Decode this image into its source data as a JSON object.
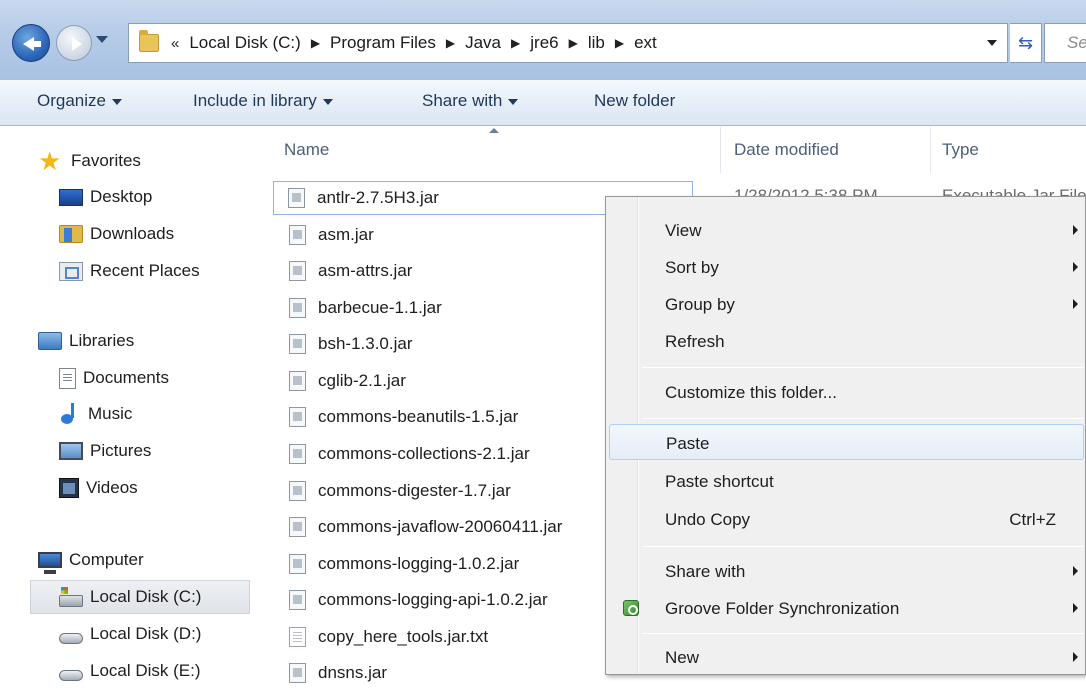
{
  "address": {
    "overflow": "«",
    "crumbs": [
      "Local Disk (C:)",
      "Program Files",
      "Java",
      "jre6",
      "lib",
      "ext"
    ],
    "search_placeholder": "Sear"
  },
  "toolbar": {
    "organize": "Organize",
    "include_in_library": "Include in library",
    "share_with": "Share with",
    "new_folder": "New folder"
  },
  "nav": {
    "favorites": "Favorites",
    "desktop": "Desktop",
    "downloads": "Downloads",
    "recent_places": "Recent Places",
    "libraries": "Libraries",
    "documents": "Documents",
    "music": "Music",
    "pictures": "Pictures",
    "videos": "Videos",
    "computer": "Computer",
    "local_disk_c": "Local Disk (C:)",
    "local_disk_d": "Local Disk (D:)",
    "local_disk_e": "Local Disk (E:)"
  },
  "columns": {
    "name": "Name",
    "date_modified": "Date modified",
    "type": "Type"
  },
  "files": [
    "antlr-2.7.5H3.jar",
    "asm.jar",
    "asm-attrs.jar",
    "barbecue-1.1.jar",
    "bsh-1.3.0.jar",
    "cglib-2.1.jar",
    "commons-beanutils-1.5.jar",
    "commons-collections-2.1.jar",
    "commons-digester-1.7.jar",
    "commons-javaflow-20060411.jar",
    "commons-logging-1.0.2.jar",
    "commons-logging-api-1.0.2.jar",
    "copy_here_tools.jar.txt",
    "dnsns.jar"
  ],
  "first_row": {
    "date": "1/28/2012 5:38 PM",
    "type": "Executable Jar File"
  },
  "context_menu": {
    "view": "View",
    "sort_by": "Sort by",
    "group_by": "Group by",
    "refresh": "Refresh",
    "customize": "Customize this folder...",
    "paste": "Paste",
    "paste_shortcut": "Paste shortcut",
    "undo_copy": "Undo Copy",
    "undo_copy_shortcut": "Ctrl+Z",
    "share_with": "Share with",
    "groove": "Groove Folder Synchronization",
    "new": "New"
  }
}
